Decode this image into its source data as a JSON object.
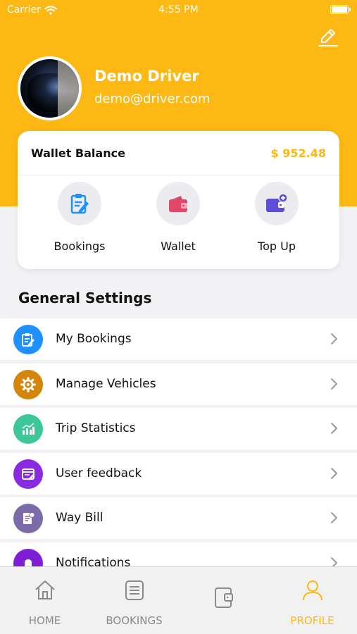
{
  "status_bar": {
    "carrier": "Carrier",
    "time": "4:55 PM"
  },
  "profile": {
    "name": "Demo Driver",
    "email": "demo@driver.com"
  },
  "wallet": {
    "title": "Wallet Balance",
    "amount": "$ 952.48",
    "actions": [
      {
        "label": "Bookings",
        "icon": "bookings-clipboard-icon"
      },
      {
        "label": "Wallet",
        "icon": "wallet-icon"
      },
      {
        "label": "Top Up",
        "icon": "top-up-icon"
      }
    ]
  },
  "settings": {
    "title": "General Settings",
    "items": [
      {
        "label": "My Bookings",
        "icon": "clipboard-icon",
        "color": "#1E90FF"
      },
      {
        "label": "Manage Vehicles",
        "icon": "gear-icon",
        "color": "#D4860B"
      },
      {
        "label": "Trip Statistics",
        "icon": "chart-icon",
        "color": "#3CC79A"
      },
      {
        "label": "User feedback",
        "icon": "feedback-icon",
        "color": "#8A2BE2"
      },
      {
        "label": "Way Bill",
        "icon": "waybill-icon",
        "color": "#7B6BA8"
      },
      {
        "label": "Notifications",
        "icon": "bell-icon",
        "color": "#7E1FD6"
      }
    ]
  },
  "tabs": [
    {
      "label": "HOME",
      "icon": "home-icon",
      "active": false
    },
    {
      "label": "BOOKINGS",
      "icon": "list-icon",
      "active": false
    },
    {
      "label": "",
      "icon": "wallet-icon",
      "active": false
    },
    {
      "label": "PROFILE",
      "icon": "person-icon",
      "active": true
    }
  ],
  "colors": {
    "accent": "#FDB813",
    "background": "#F2F2F4"
  }
}
